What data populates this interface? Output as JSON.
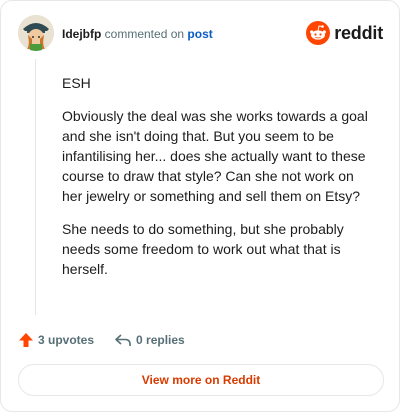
{
  "comment": {
    "username": "Idejbfp",
    "action_text": "commented on",
    "post_link": "post",
    "paragraphs": [
      "ESH",
      "Obviously the deal was she works towards a goal and she isn't doing that. But you seem to be infantilising her... does she actually want to these course to draw that style? Can she not work on her jewelry or something and sell them on Etsy?",
      "She needs to do something, but she probably needs some freedom to work out what that is herself."
    ],
    "upvotes_label": "3 upvotes",
    "replies_label": "0 replies"
  },
  "brand": {
    "name": "reddit",
    "accent": "#ff4500"
  },
  "view_more_label": "View more on Reddit",
  "colors": {
    "upvote_arrow": "#ff4500",
    "view_more_text": "#d93a00",
    "link": "#0a5cc4"
  }
}
